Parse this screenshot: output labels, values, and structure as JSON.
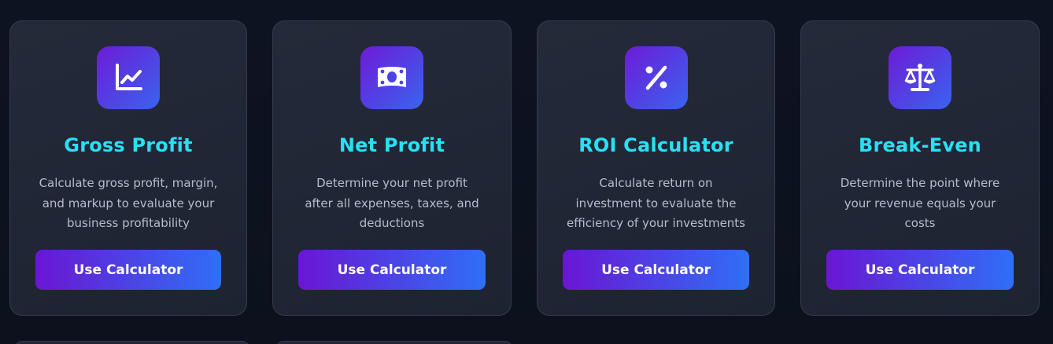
{
  "cards": [
    {
      "icon": "chart-line-icon",
      "title": "Gross Profit",
      "description": "Calculate gross profit, margin, and markup to evaluate your business profitability",
      "button_label": "Use Calculator"
    },
    {
      "icon": "money-bill-icon",
      "title": "Net Profit",
      "description": "Determine your net profit after all expenses, taxes, and deductions",
      "button_label": "Use Calculator"
    },
    {
      "icon": "percent-icon",
      "title": "ROI Calculator",
      "description": "Calculate return on investment to evaluate the efficiency of your investments",
      "button_label": "Use Calculator"
    },
    {
      "icon": "balance-scale-icon",
      "title": "Break-Even",
      "description": "Determine the point where your revenue equals your costs",
      "button_label": "Use Calculator"
    }
  ],
  "colors": {
    "title": "#29e0f5",
    "accent_start": "#6a16d4",
    "accent_end": "#2f6ff6",
    "background": "#0d1220",
    "card": "#222736"
  }
}
